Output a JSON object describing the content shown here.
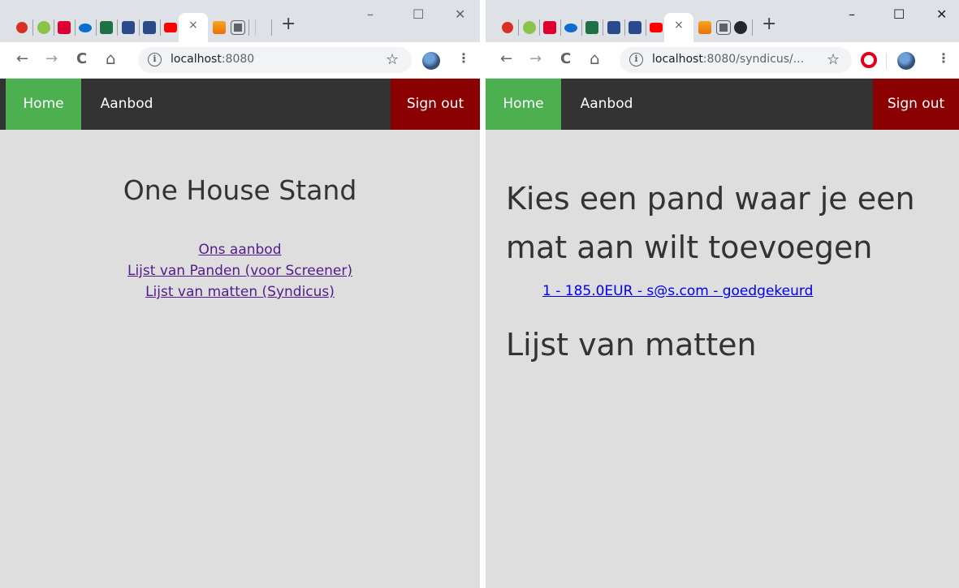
{
  "browser": {
    "new_tab": "+",
    "close_tab": "×",
    "minimize": "–",
    "maximize": "☐",
    "close_window": "✕",
    "back": "←",
    "forward": "→",
    "reload": "C",
    "home": "⌂",
    "info": "i",
    "star": "☆",
    "menu": "⋮",
    "left_url": {
      "host": "localhost",
      "rest": ":8080"
    },
    "right_url": {
      "host": "localhost",
      "rest": ":8080/syndicus/..."
    }
  },
  "nav": {
    "home": "Home",
    "aanbod": "Aanbod",
    "signout": "Sign out"
  },
  "left_page": {
    "title": "One House Stand",
    "links": [
      "Ons aanbod",
      "Lijst van Panden (voor Screener)",
      "Lijst van matten (Syndicus)"
    ]
  },
  "right_page": {
    "title": "Kies een pand waar je een mat aan wilt toevoegen",
    "pand_link": "1 - 185.0EUR - s@s.com - goedgekeurd",
    "subtitle": "Lijst van matten"
  },
  "colors": {
    "nav_bg": "#333333",
    "home_bg": "#4caf50",
    "signout_bg": "#8b0000",
    "page_bg": "#dedede",
    "visited_link": "#551a8b",
    "link": "#0000ee"
  }
}
